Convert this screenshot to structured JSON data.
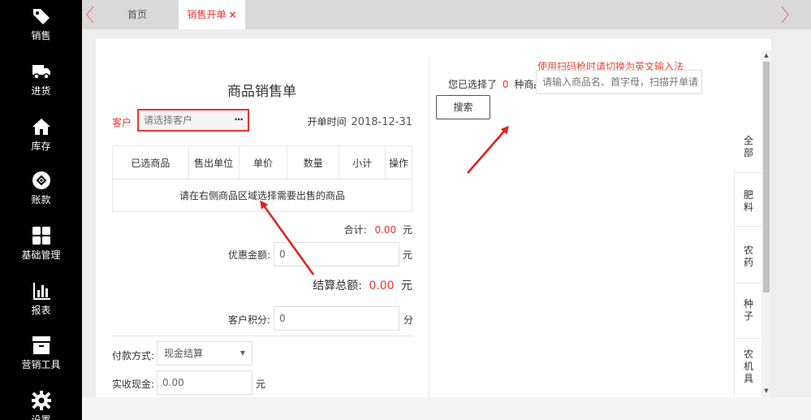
{
  "sidebar": {
    "items": [
      {
        "label": "销售",
        "icon": "tag-icon"
      },
      {
        "label": "进货",
        "icon": "truck-icon"
      },
      {
        "label": "库存",
        "icon": "home-icon"
      },
      {
        "label": "账款",
        "icon": "money-icon"
      },
      {
        "label": "基础管理",
        "icon": "grid-icon"
      },
      {
        "label": "报表",
        "icon": "bar-chart-icon"
      },
      {
        "label": "营销工具",
        "icon": "archive-icon"
      },
      {
        "label": "设置",
        "icon": "gear-icon"
      }
    ]
  },
  "tabs": {
    "home": "首页",
    "active": "销售开单",
    "close": "×"
  },
  "form": {
    "title": "商品销售单",
    "customer_label": "客户",
    "customer_placeholder": "请选择客户",
    "customer_more": "···",
    "open_time_label": "开单时间",
    "open_time_value": "2018-12-31",
    "table_headers": [
      "已选商品",
      "售出单位",
      "单价",
      "数量",
      "小计",
      "操作"
    ],
    "table_empty": "请在右侧商品区域选择需要出售的商品",
    "subtotal_label": "合计:",
    "subtotal_value": "0.00",
    "currency_unit": "元",
    "discount_label": "优惠金额:",
    "discount_value": "0",
    "total_label": "结算总额:",
    "total_value": "0.00",
    "points_label": "客户积分:",
    "points_value": "0",
    "points_unit": "分",
    "payment_label": "付款方式:",
    "payment_value": "现金结算",
    "cash_label": "实收现金:",
    "cash_value": "0.00"
  },
  "right": {
    "hint": "使用扫码枪时请切换为英文输入法",
    "chosen_prefix": "您已选择了",
    "chosen_count": "0",
    "chosen_suffix": "种商品",
    "search_placeholder": "请输入商品名、首字母，扫描开单请",
    "search_button": "搜索",
    "categories": [
      "全\n部",
      "肥\n料",
      "农\n药",
      "种\n子",
      "农\n机\n具"
    ]
  },
  "colors": {
    "accent": "#e33333",
    "sidebar_bg": "#000000",
    "annotation_arrow": "#e02020"
  }
}
